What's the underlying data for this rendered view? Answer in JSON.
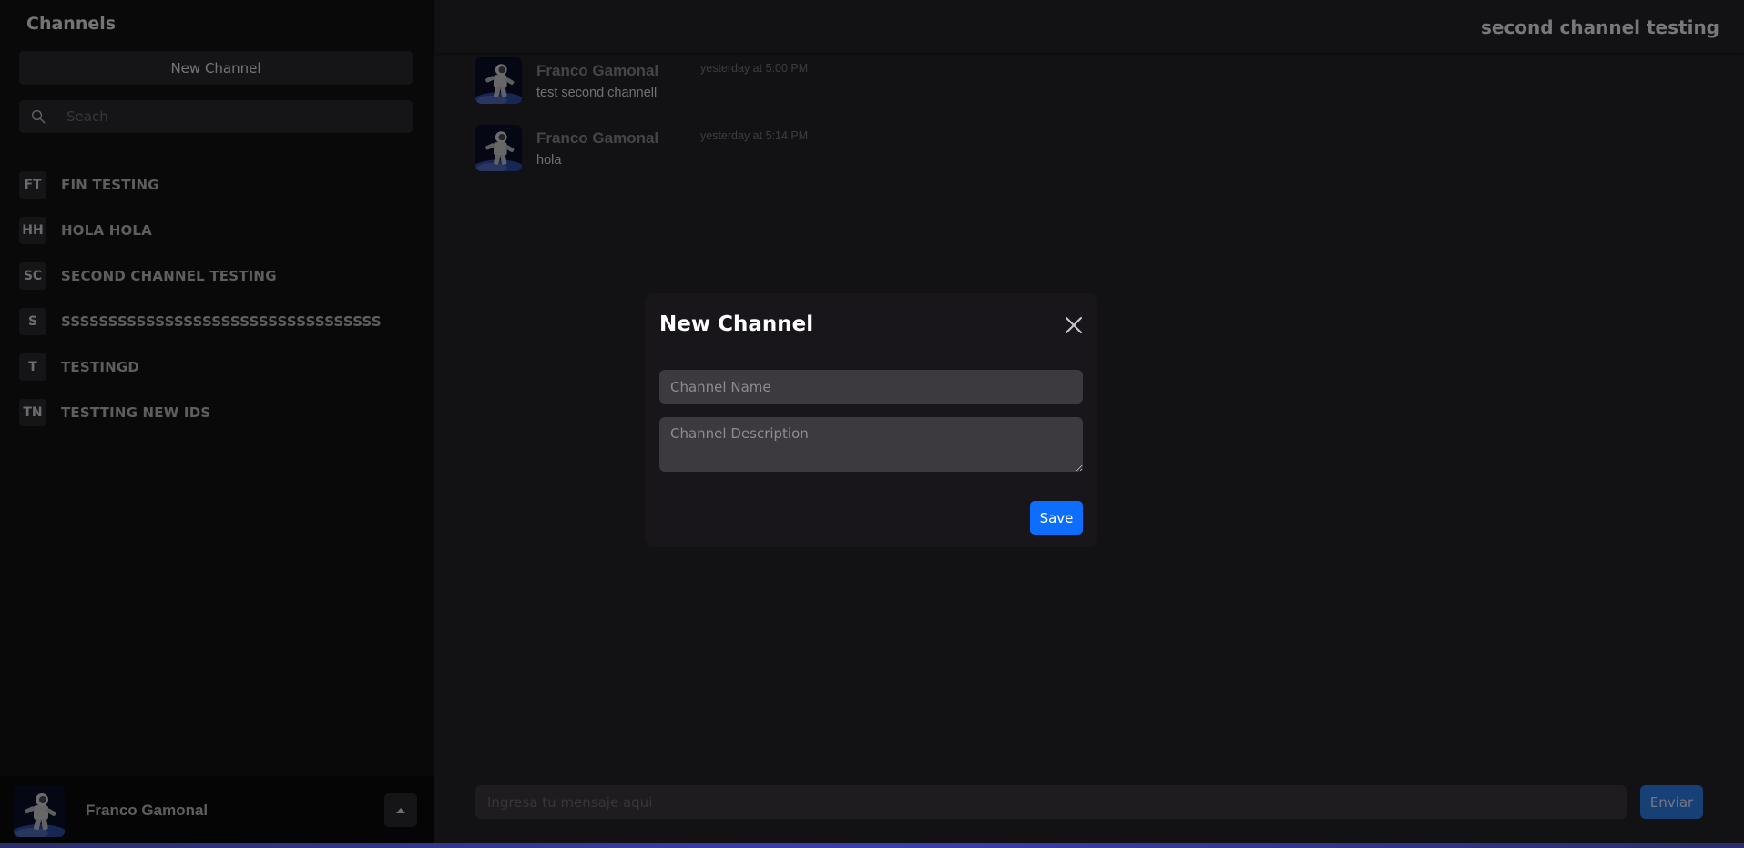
{
  "sidebar": {
    "title": "Channels",
    "new_channel_label": "New Channel",
    "search_placeholder": "Seach",
    "channels": [
      {
        "initials": "FT",
        "name": "FIN TESTING"
      },
      {
        "initials": "HH",
        "name": "HOLA HOLA"
      },
      {
        "initials": "SC",
        "name": "SECOND CHANNEL TESTING"
      },
      {
        "initials": "S",
        "name": "SSSSSSSSSSSSSSSSSSSSSSSSSSSSSSSSSS"
      },
      {
        "initials": "T",
        "name": "TESTINGD"
      },
      {
        "initials": "TN",
        "name": "TESTTING NEW IDS"
      }
    ],
    "user": {
      "name": "Franco Gamonal",
      "menu_icon": "caret-up-icon"
    }
  },
  "main": {
    "channel_title": "second channel testing",
    "messages": [
      {
        "author": "Franco Gamonal",
        "time": "yesterday at 5:00 PM",
        "text": "test second channell"
      },
      {
        "author": "Franco Gamonal",
        "time": "yesterday at 5:14 PM",
        "text": "hola"
      }
    ],
    "composer_placeholder": "Ingresa tu mensaje aqui",
    "send_label": "Enviar"
  },
  "modal": {
    "title": "New Channel",
    "name_placeholder": "Channel Name",
    "description_placeholder": "Channel Description",
    "save_label": "Save"
  },
  "colors": {
    "accent": "#0d6efd",
    "send_button": "#2f80ed",
    "sidebar_bg": "#131214",
    "main_bg": "#252329"
  }
}
